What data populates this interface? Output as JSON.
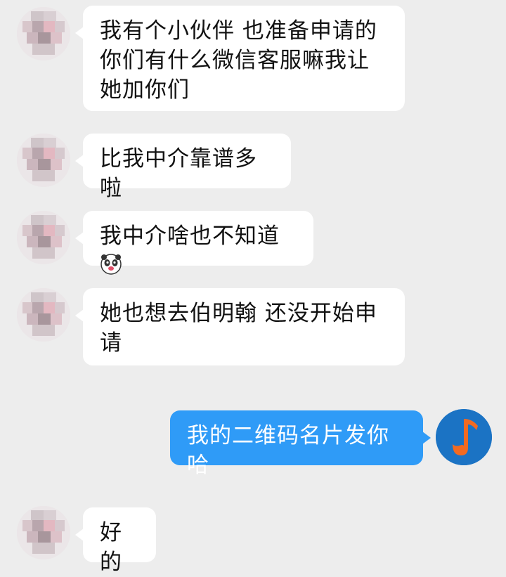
{
  "messages": [
    {
      "side": "left",
      "text": "我有个小伙伴 也准备申请的你们有什么微信客服嘛我让她加你们"
    },
    {
      "side": "left",
      "text": "比我中介靠谱多啦"
    },
    {
      "side": "left",
      "text": "我中介啥也不知道",
      "emoji": "panda-face-icon"
    },
    {
      "side": "left",
      "text": "她也想去伯明翰 还没开始申请"
    },
    {
      "side": "right",
      "text": "我的二维码名片发你哈"
    },
    {
      "side": "left",
      "text": "好的"
    }
  ],
  "colors": {
    "background": "#ededed",
    "incoming_bubble": "#ffffff",
    "outgoing_bubble": "#2f9bf7",
    "self_avatar_bg": "#1b73c4",
    "self_avatar_mark": "#f26a21"
  }
}
